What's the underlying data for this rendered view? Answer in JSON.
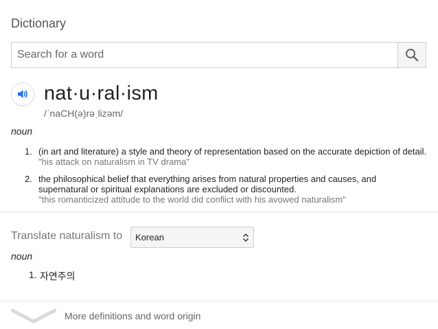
{
  "header": {
    "title": "Dictionary"
  },
  "search": {
    "placeholder": "Search for a word"
  },
  "entry": {
    "headword": "nat·u·ral·ism",
    "phonetic": "/ˈnaCH(ə)rəˌlizəm/",
    "part_of_speech": "noun",
    "definitions": [
      {
        "number": "1.",
        "text": "(in art and literature) a style and theory of representation based on the accurate depiction of detail.",
        "example": "\"his attack on naturalism in TV drama\""
      },
      {
        "number": "2.",
        "lines": [
          "the philosophical belief that everything arises from natural properties and causes, and",
          "supernatural or spiritual explanations are excluded or discounted."
        ],
        "example": "\"this romanticized attitude to the world did conflict with his avowed naturalism\""
      }
    ]
  },
  "translate": {
    "label": "Translate naturalism to",
    "language": "Korean",
    "part_of_speech": "noun",
    "results": [
      {
        "number": "1.",
        "text": "자연주의"
      }
    ]
  },
  "footer": {
    "more_label": "More definitions and word origin"
  },
  "colors": {
    "accent_blue": "#1a73e8",
    "muted_text": "#777777",
    "border": "#d0d0d0"
  },
  "icons": {
    "search": "search-icon",
    "speaker": "speaker-icon",
    "select_arrows": "select-arrows-icon",
    "expand": "chevron-down-icon"
  }
}
